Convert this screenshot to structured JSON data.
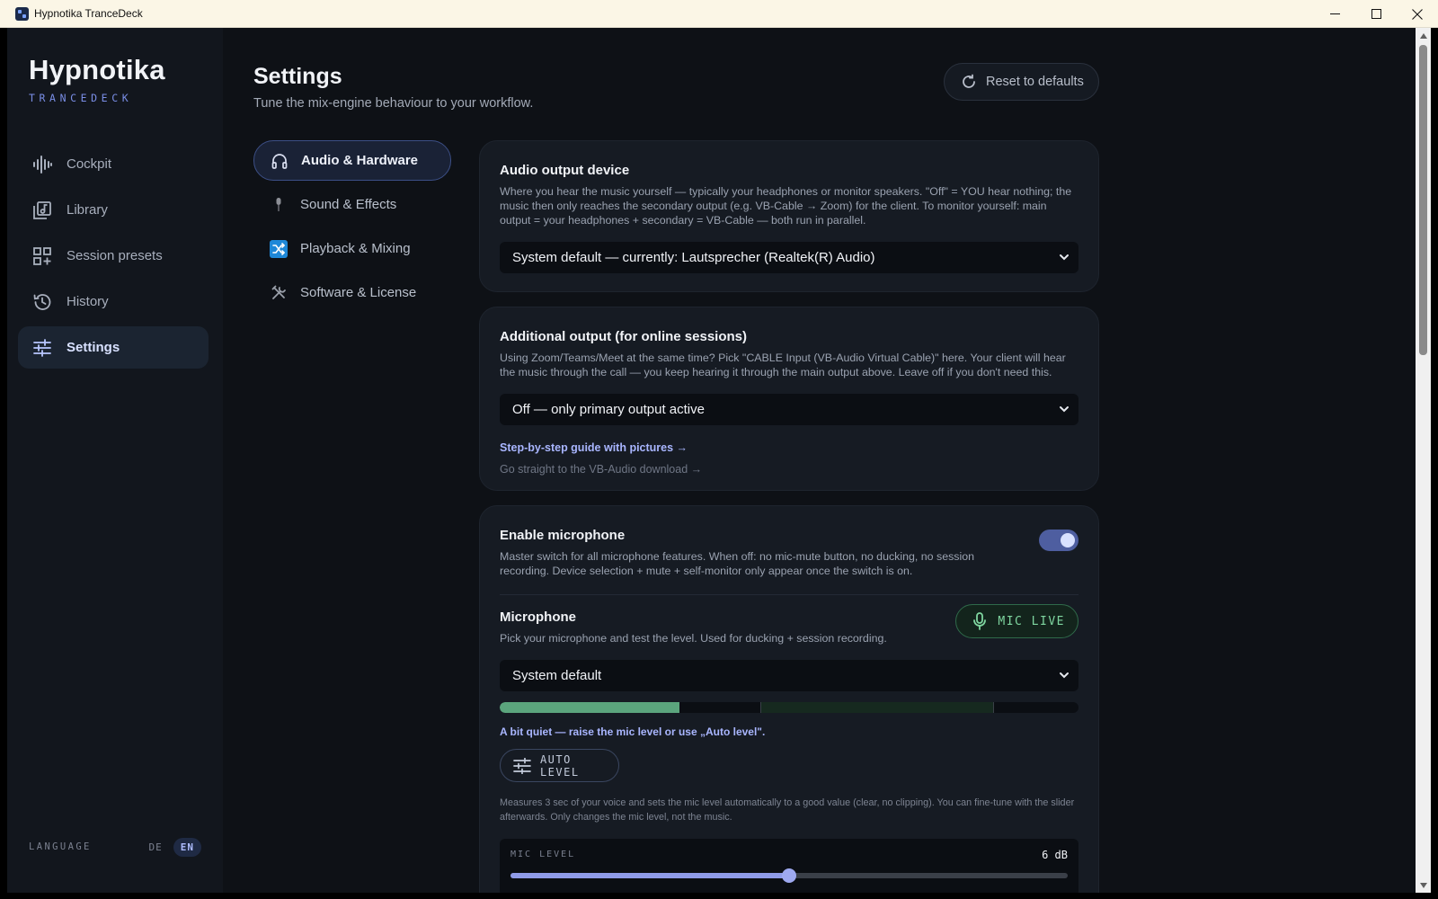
{
  "window": {
    "title": "Hypnotika TranceDeck",
    "controls": [
      "minimize-icon",
      "maximize-icon",
      "close-icon"
    ]
  },
  "brand": {
    "title": "Hypnotika",
    "subtitle": "TRANCEDECK"
  },
  "sidebar": {
    "items": [
      {
        "label": "Cockpit",
        "icon": "waveform-icon",
        "active": false
      },
      {
        "label": "Library",
        "icon": "music-library-icon",
        "active": false
      },
      {
        "label": "Session presets",
        "icon": "grid-add-icon",
        "active": false
      },
      {
        "label": "History",
        "icon": "history-icon",
        "active": false
      },
      {
        "label": "Settings",
        "icon": "sliders-icon",
        "active": true
      }
    ],
    "language": {
      "label": "LANGUAGE",
      "options": [
        "DE",
        "EN"
      ],
      "selected": "EN"
    }
  },
  "header": {
    "title": "Settings",
    "subtitle": "Tune the mix-engine behaviour to your workflow.",
    "reset_label": "Reset to defaults"
  },
  "subnav": {
    "items": [
      {
        "label": "Audio & Hardware",
        "icon": "headphones-icon",
        "active": true
      },
      {
        "label": "Sound & Effects",
        "icon": "microphone-emoji-icon",
        "active": false
      },
      {
        "label": "Playback & Mixing",
        "icon": "shuffle-icon",
        "active": false
      },
      {
        "label": "Software & License",
        "icon": "tools-icon",
        "active": false
      }
    ]
  },
  "audio_output": {
    "title": "Audio output device",
    "description": "Where you hear the music yourself — typically your headphones or monitor speakers. \"Off\" = YOU hear nothing; the music then only reaches the secondary output (e.g. VB-Cable → Zoom) for the client. To monitor yourself: main output = your headphones + secondary = VB-Cable — both run in parallel.",
    "selected": "System default — currently: Lautsprecher (Realtek(R) Audio)"
  },
  "additional_output": {
    "title": "Additional output (for online sessions)",
    "description": "Using Zoom/Teams/Meet at the same time? Pick \"CABLE Input (VB-Audio Virtual Cable)\" here. Your client will hear the music through the call — you keep hearing it through the main output above. Leave off if you don't need this.",
    "selected": "Off — only primary output active",
    "guide_link": "Step-by-step guide with pictures →",
    "download_link": "Go straight to the VB-Audio download →"
  },
  "microphone": {
    "enable_title": "Enable microphone",
    "enable_description": "Master switch for all microphone features. When off: no mic-mute button, no ducking, no session recording. Device selection + mute + self-monitor only appear once the switch is on.",
    "enabled": true,
    "title": "Microphone",
    "description": "Pick your microphone and test the level. Used for ducking + session recording.",
    "live_label": "MIC LIVE",
    "device_selected": "System default",
    "meter_level": 0.31,
    "meter_target_zone": [
      0.45,
      0.853
    ],
    "hint": "A bit quiet — raise the mic level or use „Auto level\".",
    "auto_level_label": "AUTO LEVEL",
    "auto_level_description": "Measures 3 sec of your voice and sets the mic level automatically to a good value (clear, no clipping). You can fine-tune with the slider afterwards. Only changes the mic level, not the music.",
    "level_label": "MIC LEVEL",
    "level_value": "6 dB",
    "level_fraction": 0.5
  },
  "colors": {
    "accent": "#7a8ee6",
    "live_green": "#7fd6a0",
    "meter_green": "#5ba57d",
    "link_blue": "#a9b6ff"
  }
}
